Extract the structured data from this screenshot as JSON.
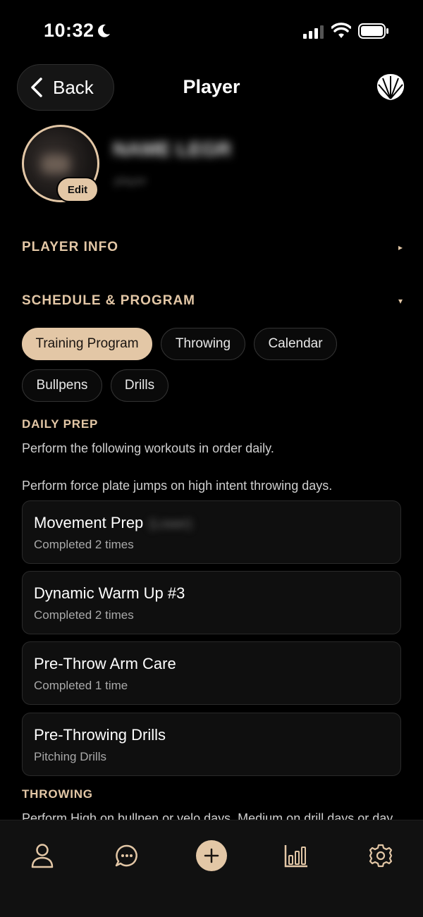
{
  "status": {
    "time": "10:32"
  },
  "header": {
    "back_label": "Back",
    "title": "Player"
  },
  "profile": {
    "edit_label": "Edit",
    "name_redacted": "NAME LEGR",
    "subtitle_redacted": "player"
  },
  "sections": {
    "player_info": {
      "label": "PLAYER INFO",
      "indicator": "▸"
    },
    "schedule": {
      "label": "SCHEDULE & PROGRAM",
      "indicator": "▾"
    }
  },
  "pills": [
    {
      "label": "Training Program",
      "active": true
    },
    {
      "label": "Throwing",
      "active": false
    },
    {
      "label": "Calendar",
      "active": false
    },
    {
      "label": "Bullpens",
      "active": false
    },
    {
      "label": "Drills",
      "active": false
    }
  ],
  "daily_prep": {
    "heading": "DAILY PREP",
    "desc1": "Perform the following workouts in order daily.",
    "desc2": "Perform force plate jumps on high intent throwing days."
  },
  "cards": [
    {
      "title": "Movement Prep",
      "subtitle": "Completed 2 times",
      "redacted": "(Lower)"
    },
    {
      "title": "Dynamic Warm Up #3",
      "subtitle": "Completed 2 times"
    },
    {
      "title": "Pre-Throw Arm Care",
      "subtitle": "Completed 1 time"
    },
    {
      "title": "Pre-Throwing Drills",
      "subtitle": "Pitching Drills"
    }
  ],
  "throwing": {
    "heading": "THROWING",
    "desc": "Perform High on bullpen or velo days. Medium on drill days or day"
  },
  "tabbar": {
    "icons": [
      "person-icon",
      "chat-icon",
      "plus-icon",
      "chart-icon",
      "gear-icon"
    ]
  },
  "colors": {
    "accent": "#e3c7a6",
    "background": "#000000",
    "card": "#0f0f0f"
  }
}
